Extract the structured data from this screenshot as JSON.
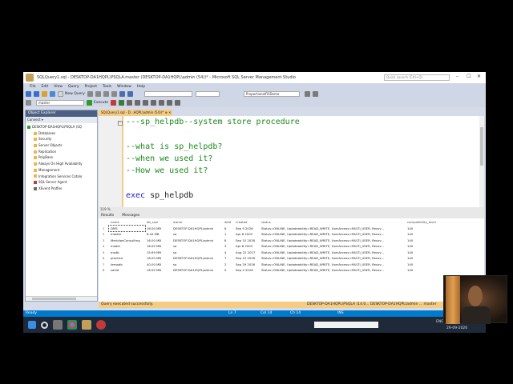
{
  "window": {
    "title": "SQLQuery1.sql - DESKTOP-DA1HQPL\\PSQLA.master (DESKTOP-DA1HQPL\\admin (54))* - Microsoft SQL Server Management Studio",
    "quick_launch_placeholder": "Quick Launch (Ctrl+Q)",
    "minimize": "–",
    "maximize": "☐",
    "close": "✕"
  },
  "menu": [
    "File",
    "Edit",
    "View",
    "Query",
    "Project",
    "Tools",
    "Window",
    "Help"
  ],
  "toolbar": {
    "new_query": "New Query",
    "execute": "Execute",
    "database": "master",
    "font_combo": "ProportionalFillDemo"
  },
  "object_explorer": {
    "title": "Object Explorer",
    "connect": "Connect ▾",
    "items": [
      "DESKTOP-DA1HQPL\\PSQLA (SQ",
      "Databases",
      "Security",
      "Server Objects",
      "Replication",
      "PolyBase",
      "Always On High Availability",
      "Management",
      "Integration Services Catalo",
      "SQL Server Agent",
      "XEvent Profiler"
    ]
  },
  "doc_tab": "SQLQuery1.sql - D...HQPL\\admin (54))* ⊕ ✕",
  "editor": {
    "line1": "---sp_helpdb--system store procedure",
    "line2": "--what is sp_helpdb?",
    "line3": "--when we used it?",
    "line4": "--How we used it?",
    "line5_kw": "exec",
    "line5_rest": " sp_helpdb"
  },
  "zoom": "119 %",
  "results": {
    "tab_results": "Results",
    "tab_messages": "Messages",
    "columns": [
      "name",
      "db_size",
      "owner",
      "dbid",
      "created",
      "status",
      "compatibility_level"
    ],
    "rows": [
      [
        "1",
        "DMS",
        "16.00 MB",
        "DESKTOP-DA1HQPL\\admin",
        "6",
        "Sep 9 2026",
        "Status=ONLINE, Updateability=READ_WRITE, UserAccess=MULTI_USER, Recov...",
        "140"
      ],
      [
        "2",
        "master",
        "6.44 MB",
        "sa",
        "1",
        "Apr 8 2003",
        "Status=ONLINE, Updateability=READ_WRITE, UserAccess=MULTI_USER, Recov...",
        "140"
      ],
      [
        "3",
        "MeridianConsulting",
        "16.00 MB",
        "DESKTOP-DA1HQPL\\admin",
        "8",
        "Sep 15 2026",
        "Status=ONLINE, Updateability=READ_WRITE, UserAccess=MULTI_USER, Recov...",
        "140"
      ],
      [
        "4",
        "model",
        "16.00 MB",
        "sa",
        "3",
        "Apr 8 2003",
        "Status=ONLINE, Updateability=READ_WRITE, UserAccess=MULTI_USER, Recov...",
        "140"
      ],
      [
        "5",
        "msdb",
        "15.69 MB",
        "sa",
        "4",
        "Aug 22 2017",
        "Status=ONLINE, Updateability=READ_WRITE, UserAccess=MULTI_USER, Recov...",
        "140"
      ],
      [
        "6",
        "practice",
        "16.00 MB",
        "DESKTOP-DA1HQPL\\admin",
        "7",
        "Sep 15 2026",
        "Status=ONLINE, Updateability=READ_WRITE, UserAccess=MULTI_USER, Recov...",
        "140"
      ],
      [
        "7",
        "tempdb",
        "40.00 MB",
        "sa",
        "2",
        "Sep 29 2026",
        "Status=ONLINE, Updateability=READ_WRITE, UserAccess=MULTI_USER, Recov...",
        "140"
      ],
      [
        "8",
        "zahid",
        "16.00 MB",
        "DESKTOP-DA1HQPL\\admin",
        "5",
        "Sep 4 2026",
        "Status=ONLINE, Updateability=READ_WRITE, UserAccess=MULTI_USER, Recov...",
        "140"
      ]
    ]
  },
  "query_status": {
    "message": "Query executed successfully.",
    "right": "DESKTOP-DA1HQPL\\PSQLA (14.0...   DESKTOP-DA1HQPL\\admin ...   master"
  },
  "status_bar": {
    "ready": "Ready",
    "ln": "Ln 7",
    "col": "Col 14",
    "ch": "Ch 14",
    "ins": "INS"
  },
  "tray": {
    "lang": "ENG",
    "time": "29-09-2026"
  },
  "colors": {
    "ssms_blue": "#007acc",
    "tab_yellow": "#f5cc84",
    "comment_green": "#1a8a1a",
    "keyword_blue": "#2020c0"
  }
}
